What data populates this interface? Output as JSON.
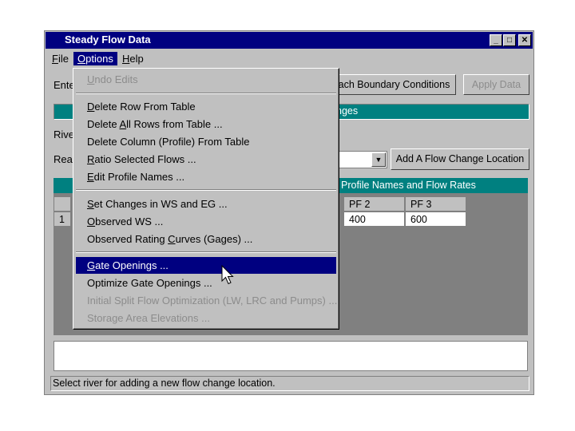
{
  "window": {
    "title": "Steady Flow Data",
    "controls": {
      "minimize": "_",
      "maximize": "□",
      "close": "✕"
    }
  },
  "menubar": {
    "file": {
      "label": "File",
      "key": "F",
      "rest": "ile"
    },
    "options": {
      "label": "Options",
      "key": "O",
      "rest": "ptions"
    },
    "help": {
      "label": "Help",
      "key": "H",
      "rest": "elp"
    }
  },
  "form": {
    "enter_label": "Ente",
    "river_label": "Rive",
    "reach_label": "Rea",
    "boundary_button": "ach Boundary Conditions",
    "apply_button": "Apply Data",
    "teal_bar_text": "nges",
    "add_flow_change_button": "Add A Flow Change Location",
    "profile_header": "Profile Names and Flow Rates"
  },
  "table": {
    "row_number": "1",
    "columns": [
      "PF 2",
      "PF 3"
    ],
    "values": [
      "400",
      "600"
    ]
  },
  "options_menu": {
    "items": [
      {
        "pre": "",
        "key": "U",
        "rest": "ndo Edits",
        "enabled": false
      },
      {
        "pre": "",
        "key": "D",
        "rest": "elete Row From Table",
        "enabled": true
      },
      {
        "pre": "Delete ",
        "key": "A",
        "rest": "ll Rows from Table ...",
        "enabled": true
      },
      {
        "pre": "Delete Column (Profile) From Table",
        "key": "",
        "rest": "",
        "enabled": true
      },
      {
        "pre": "",
        "key": "R",
        "rest": "atio Selected Flows ...",
        "enabled": true
      },
      {
        "pre": "",
        "key": "E",
        "rest": "dit Profile Names ...",
        "enabled": true
      },
      {
        "pre": "",
        "key": "S",
        "rest": "et Changes in WS and EG ...",
        "enabled": true
      },
      {
        "pre": "",
        "key": "O",
        "rest": "bserved WS ...",
        "enabled": true
      },
      {
        "pre": "Observed Rating ",
        "key": "C",
        "rest": "urves (Gages) ...",
        "enabled": true
      },
      {
        "pre": "",
        "key": "G",
        "rest": "ate Openings ...",
        "enabled": true
      },
      {
        "pre": "Optimize Gate Openings ...",
        "key": "",
        "rest": "",
        "enabled": true
      },
      {
        "pre": "Initial Split Flow Optimization (LW, LRC and Pumps) ...",
        "key": "",
        "rest": "",
        "enabled": false
      },
      {
        "pre": "Storage Area Elevations ...",
        "key": "",
        "rest": "",
        "enabled": false
      }
    ]
  },
  "status_bar": {
    "text": "Select river for adding a new flow change location."
  },
  "colors": {
    "titlebar": "#000080",
    "teal": "#008080",
    "face": "#c0c0c0",
    "highlight": "#000080"
  }
}
